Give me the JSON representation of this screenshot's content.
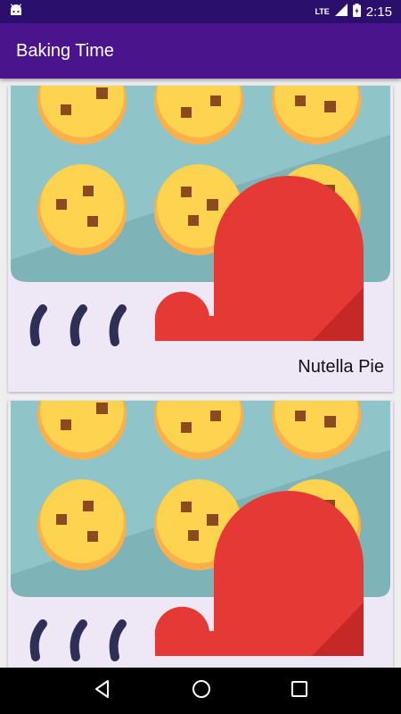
{
  "status_bar": {
    "time": "2:15",
    "network_label": "LTE",
    "icons": [
      "android-icon",
      "signal-icon",
      "battery-icon"
    ]
  },
  "app_bar": {
    "title": "Baking Time"
  },
  "recipes": [
    {
      "name": "Nutella Pie"
    },
    {
      "name": ""
    }
  ],
  "nav_bar": {
    "icons": [
      "back-icon",
      "home-icon",
      "recents-icon"
    ]
  },
  "colors": {
    "status_bar": "#2b0f6d",
    "app_bar": "#4a148c",
    "card_background": "#ede7f6",
    "tray": "#8fc4c8",
    "cookie": "#fdd34f",
    "oven_mitt": "#e53935"
  }
}
